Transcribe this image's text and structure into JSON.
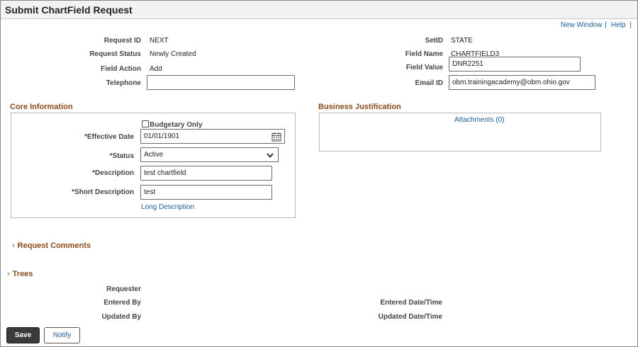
{
  "page": {
    "title": "Submit ChartField Request"
  },
  "toplinks": {
    "new_window": "New Window",
    "separator": "|",
    "help": "Help"
  },
  "header": {
    "request_id": {
      "label": "Request ID",
      "value": "NEXT"
    },
    "request_status": {
      "label": "Request Status",
      "value": "Newly Created"
    },
    "field_action": {
      "label": "Field Action",
      "value": "Add"
    },
    "telephone": {
      "label": "Telephone",
      "value": ""
    },
    "setid": {
      "label": "SetID",
      "value": "STATE"
    },
    "field_name": {
      "label": "Field Name",
      "value": "CHARTFIELD3"
    },
    "field_value": {
      "label": "Field Value",
      "value": "DNR2251"
    },
    "email_id": {
      "label": "Email ID",
      "value": "obm.trainingacademy@obm.ohio.gov"
    }
  },
  "core": {
    "title": "Core Information",
    "budgetary_only": {
      "label": "Budgetary Only",
      "checked": false
    },
    "effective_date": {
      "label": "*Effective Date",
      "value": "01/01/1901"
    },
    "status": {
      "label": "*Status",
      "value": "Active"
    },
    "description": {
      "label": "*Description",
      "value": "test chartfield"
    },
    "short_description": {
      "label": "*Short Description",
      "value": "test"
    },
    "long_description_link": "Long Description"
  },
  "business": {
    "title": "Business Justification",
    "attachments_link": "Attachments (0)"
  },
  "sections": {
    "request_comments": "Request Comments",
    "trees": "Trees"
  },
  "audit": {
    "requester": "Requester",
    "entered_by": "Entered By",
    "updated_by": "Updated By",
    "entered_datetime": "Entered Date/Time",
    "updated_datetime": "Updated Date/Time"
  },
  "buttons": {
    "save": "Save",
    "notify": "Notify"
  }
}
